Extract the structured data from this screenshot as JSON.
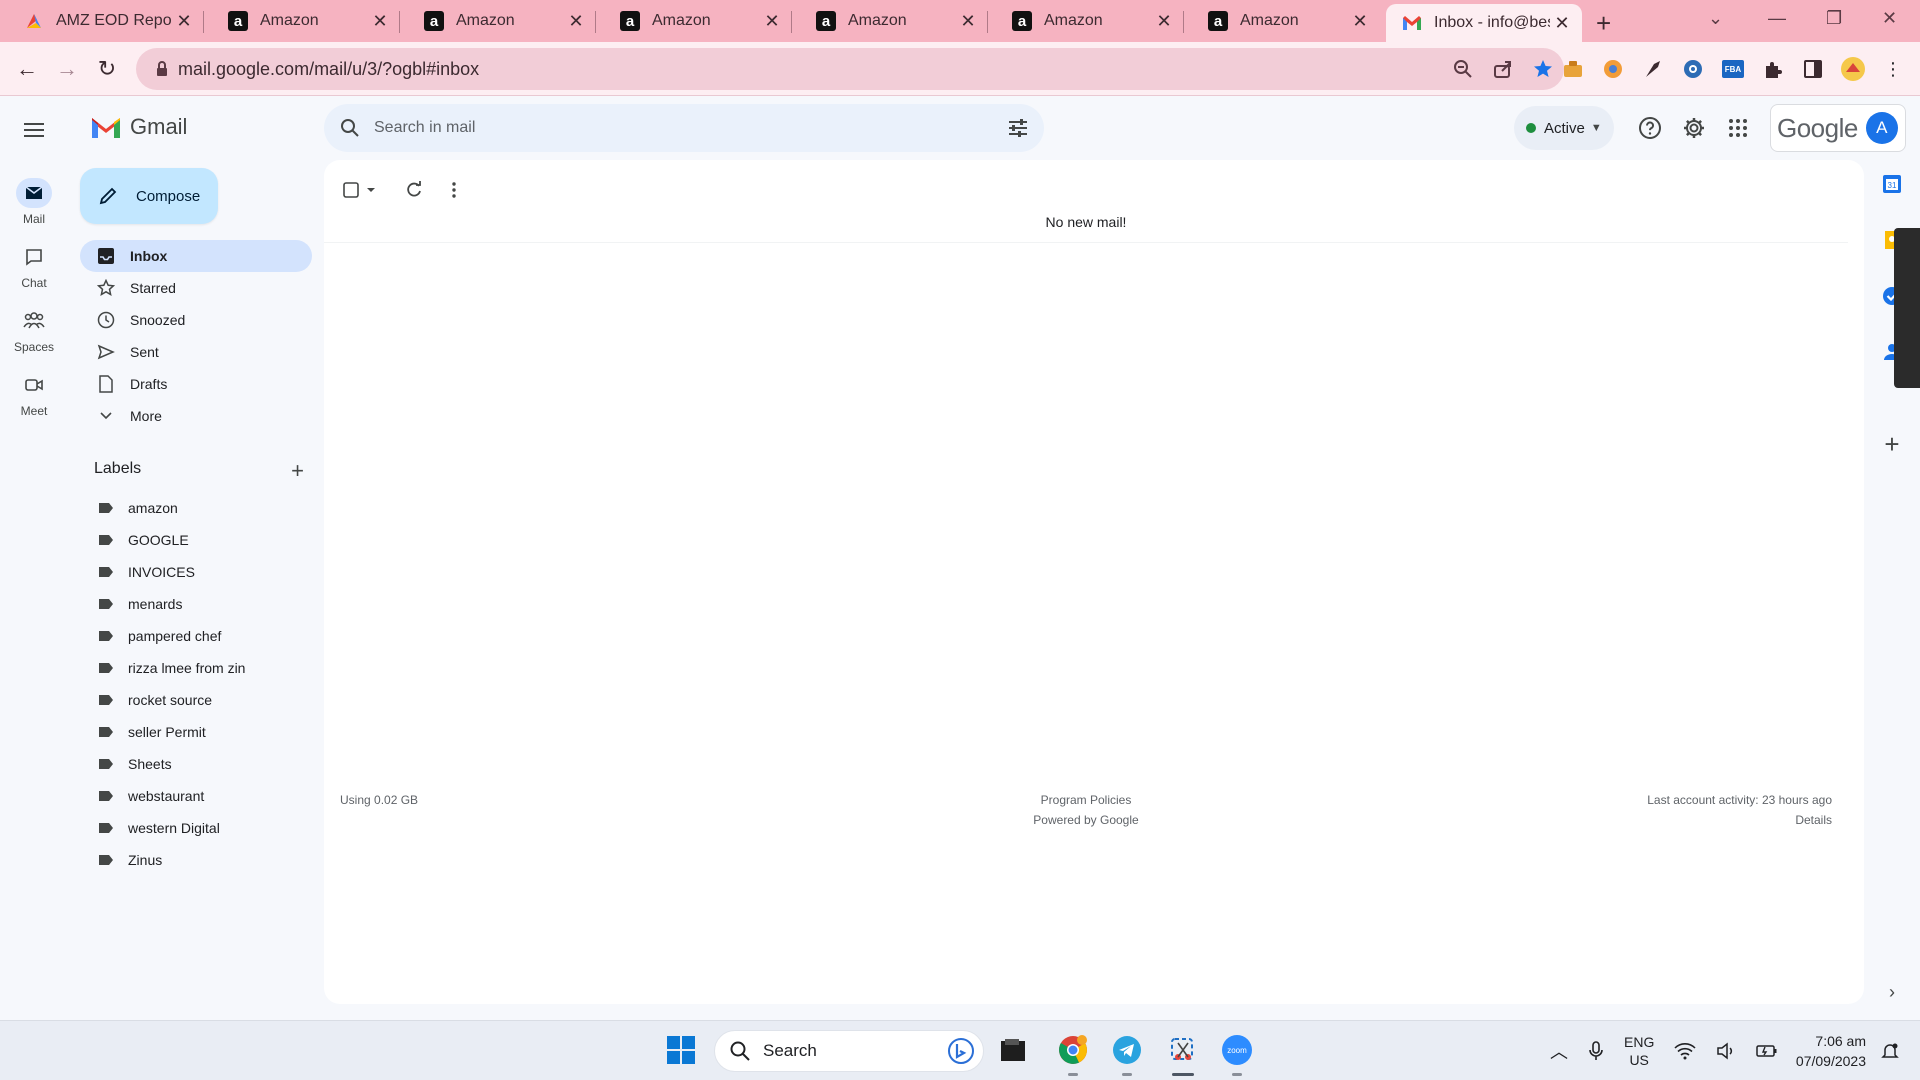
{
  "browser": {
    "tabs": [
      {
        "title": "AMZ EOD Report",
        "icon": "amz-report-icon"
      },
      {
        "title": "Amazon",
        "icon": "amazon-icon"
      },
      {
        "title": "Amazon",
        "icon": "amazon-icon"
      },
      {
        "title": "Amazon",
        "icon": "amazon-icon"
      },
      {
        "title": "Amazon",
        "icon": "amazon-icon"
      },
      {
        "title": "Amazon",
        "icon": "amazon-icon"
      },
      {
        "title": "Amazon",
        "icon": "amazon-icon"
      },
      {
        "title": "Inbox - info@bes",
        "icon": "gmail-icon",
        "active": true
      }
    ],
    "url": "mail.google.com/mail/u/3/?ogbl#inbox",
    "favicon_letter": "a",
    "ext_fba_label": "FBA"
  },
  "gmail": {
    "app_name": "Gmail",
    "rail": [
      {
        "label": "Mail",
        "icon": "mail-icon"
      },
      {
        "label": "Chat",
        "icon": "chat-icon"
      },
      {
        "label": "Spaces",
        "icon": "spaces-icon"
      },
      {
        "label": "Meet",
        "icon": "meet-icon"
      }
    ],
    "search_placeholder": "Search in mail",
    "status": "Active",
    "google_wordmark": "Google",
    "avatar_letter": "A",
    "compose_label": "Compose",
    "nav": [
      {
        "label": "Inbox",
        "icon": "inbox-icon",
        "active": true
      },
      {
        "label": "Starred",
        "icon": "star-icon"
      },
      {
        "label": "Snoozed",
        "icon": "clock-icon"
      },
      {
        "label": "Sent",
        "icon": "send-icon"
      },
      {
        "label": "Drafts",
        "icon": "draft-icon"
      },
      {
        "label": "More",
        "icon": "chevron-down-icon"
      }
    ],
    "labels_title": "Labels",
    "labels": [
      "amazon",
      "GOOGLE",
      "INVOICES",
      "menards",
      "pampered chef",
      "rizza lmee from zin",
      "rocket source",
      "seller Permit",
      "Sheets",
      "webstaurant",
      "western Digital",
      "Zinus"
    ],
    "empty_message": "No new mail!",
    "footer": {
      "storage": "Using 0.02 GB",
      "policies": "Program Policies",
      "powered": "Powered by Google",
      "activity": "Last account activity: 23 hours ago",
      "details": "Details"
    },
    "side_calendar_label": "31"
  },
  "taskbar": {
    "search_label": "Search",
    "lang_line1": "ENG",
    "lang_line2": "US",
    "time": "7:06 am",
    "date": "07/09/2023",
    "zoom_label": "zoom"
  },
  "colors": {
    "tab_bar": "#f6b3c1",
    "active_tab": "#fdeef2",
    "compose": "#c2e7ff",
    "selected_nav": "#d3e3fd",
    "status_green": "#1e8e3e",
    "avatar": "#1a73e8"
  }
}
